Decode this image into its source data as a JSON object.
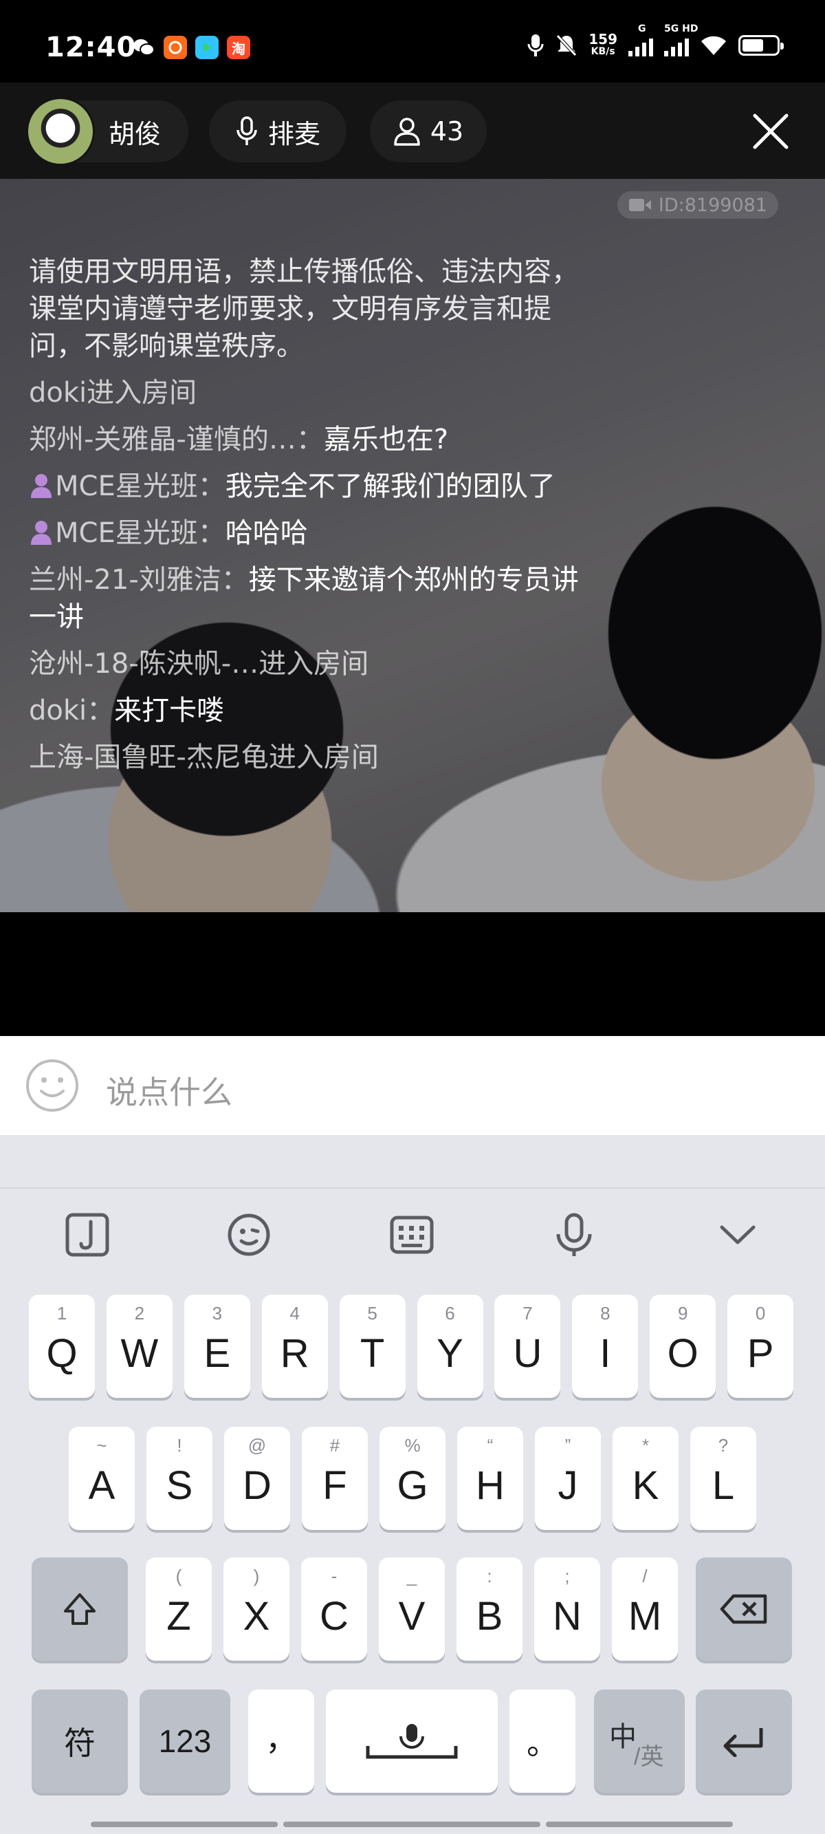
{
  "status_bar": {
    "time": "12:40",
    "net_speed_value": "159",
    "net_speed_unit": "KB/s",
    "net_type_1": "G",
    "net_type_2": "5G HD"
  },
  "header": {
    "host_name": "胡俊",
    "queue_label": "排麦",
    "viewer_count": "43"
  },
  "video": {
    "room_id": "ID:8199081"
  },
  "chat": {
    "notice": "请使用文明用语，禁止传播低俗、违法内容，课堂内请遵守老师要求，文明有序发言和提问，不影响课堂秩序。",
    "messages": [
      {
        "user": "doki进入房间",
        "text": ""
      },
      {
        "user": "郑州-关雅晶-谨慎的…：",
        "text": "嘉乐也在?"
      },
      {
        "user": "MCE星光班：",
        "text": "我完全不了解我们的团队了"
      },
      {
        "user": "MCE星光班：",
        "text": "哈哈哈"
      },
      {
        "user": "兰州-21-刘雅洁：",
        "text": "接下来邀请个郑州的专员讲一讲"
      },
      {
        "user": "沧州-18-陈泱帆-…进入房间",
        "text": ""
      },
      {
        "user": "doki：",
        "text": "来打卡喽"
      },
      {
        "user": "上海-国鲁旺-杰尼龟进入房间",
        "text": ""
      }
    ]
  },
  "comment_input": {
    "placeholder": "说点什么"
  },
  "keyboard": {
    "row1": [
      {
        "key": "Q",
        "sub": "1"
      },
      {
        "key": "W",
        "sub": "2"
      },
      {
        "key": "E",
        "sub": "3"
      },
      {
        "key": "R",
        "sub": "4"
      },
      {
        "key": "T",
        "sub": "5"
      },
      {
        "key": "Y",
        "sub": "6"
      },
      {
        "key": "U",
        "sub": "7"
      },
      {
        "key": "I",
        "sub": "8"
      },
      {
        "key": "O",
        "sub": "9"
      },
      {
        "key": "P",
        "sub": "0"
      }
    ],
    "row2": [
      {
        "key": "A",
        "sub": "~"
      },
      {
        "key": "S",
        "sub": "!"
      },
      {
        "key": "D",
        "sub": "@"
      },
      {
        "key": "F",
        "sub": "#"
      },
      {
        "key": "G",
        "sub": "%"
      },
      {
        "key": "H",
        "sub": "“"
      },
      {
        "key": "J",
        "sub": "”"
      },
      {
        "key": "K",
        "sub": "*"
      },
      {
        "key": "L",
        "sub": "?"
      }
    ],
    "row3": [
      {
        "key": "Z",
        "sub": "("
      },
      {
        "key": "X",
        "sub": ")"
      },
      {
        "key": "C",
        "sub": "-"
      },
      {
        "key": "V",
        "sub": "_"
      },
      {
        "key": "B",
        "sub": ":"
      },
      {
        "key": "N",
        "sub": ";"
      },
      {
        "key": "M",
        "sub": "/"
      }
    ],
    "symbols_label": "符",
    "numbers_label": "123",
    "comma_label": "，",
    "period_label": "。",
    "lang_label_cn": "中",
    "lang_label_en": "/英"
  },
  "colors": {
    "header_bg": "#141414",
    "keyboard_bg": "#e4e6ec",
    "fn_key": "#bcc0c9",
    "badge": "#b98ad9"
  }
}
